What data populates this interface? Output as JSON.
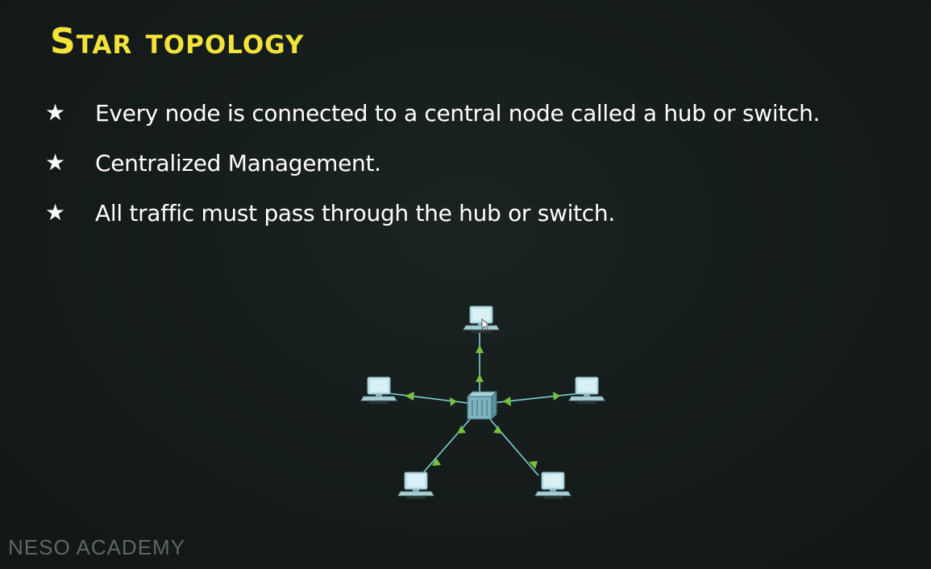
{
  "slide": {
    "title": "Star topology",
    "bullets": [
      {
        "icon": "star-bullet-icon",
        "glyph": "★",
        "text": "Every node is connected to a central node called a hub or switch."
      },
      {
        "icon": "star-bullet-icon",
        "glyph": "★",
        "text": "Centralized Management."
      },
      {
        "icon": "star-bullet-icon",
        "glyph": "★",
        "text": "All traffic must pass through the hub or switch."
      }
    ]
  },
  "diagram": {
    "hub": {
      "icon": "switch-icon"
    },
    "nodes": [
      "computer-top",
      "computer-left",
      "computer-right",
      "computer-bottom-left",
      "computer-bottom-right"
    ],
    "colors": {
      "link": "#7fd3d3",
      "arrow": "#76c043",
      "device": "#bfe4ea"
    }
  },
  "colors": {
    "title": "#f2e33a",
    "text": "#ffffff",
    "background": "#141c1b"
  },
  "watermark": "NESO ACADEMY"
}
